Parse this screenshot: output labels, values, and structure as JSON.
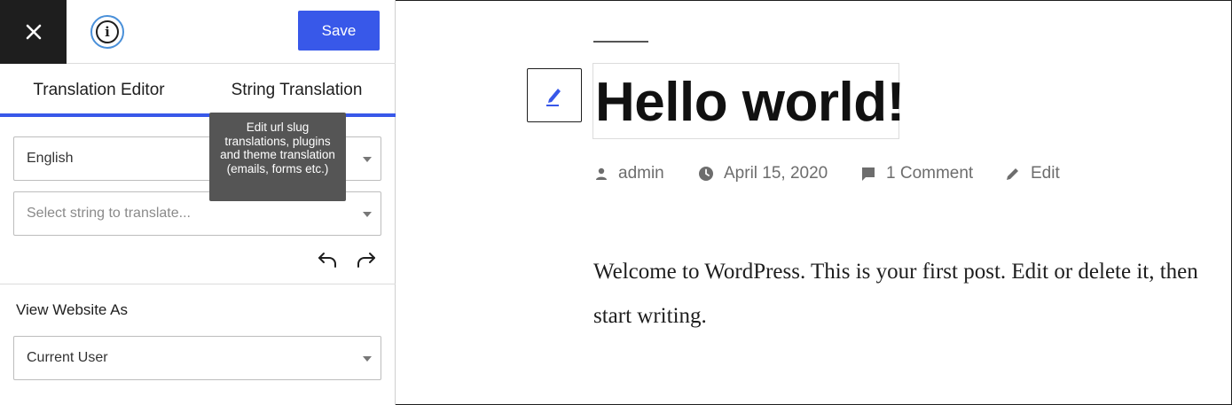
{
  "header": {
    "save_label": "Save"
  },
  "icons": {
    "close": "close-icon",
    "info": "info-icon",
    "undo": "undo-icon",
    "redo": "redo-icon",
    "pencil": "pencil-icon",
    "author": "person-icon",
    "date": "clock-icon",
    "comments": "comment-icon",
    "edit": "pencil-icon"
  },
  "tabs": [
    {
      "label": "Translation Editor"
    },
    {
      "label": "String Translation"
    }
  ],
  "tooltip": {
    "text": "Edit url slug translations, plugins and theme translation (emails, forms etc.)"
  },
  "language_select": {
    "value": "English"
  },
  "string_select": {
    "placeholder": "Select string to translate..."
  },
  "view_as": {
    "label": "View Website As",
    "value": "Current User"
  },
  "post": {
    "title": "Hello world!",
    "author": "admin",
    "date": "April 15, 2020",
    "comments": "1 Comment",
    "edit": "Edit",
    "content": "Welcome to WordPress. This is your first post. Edit or delete it, then start writing."
  },
  "colors": {
    "accent": "#3858e9",
    "dark": "#1e1e1e",
    "meta": "#6d6d6d",
    "tooltip_bg": "#555555"
  }
}
